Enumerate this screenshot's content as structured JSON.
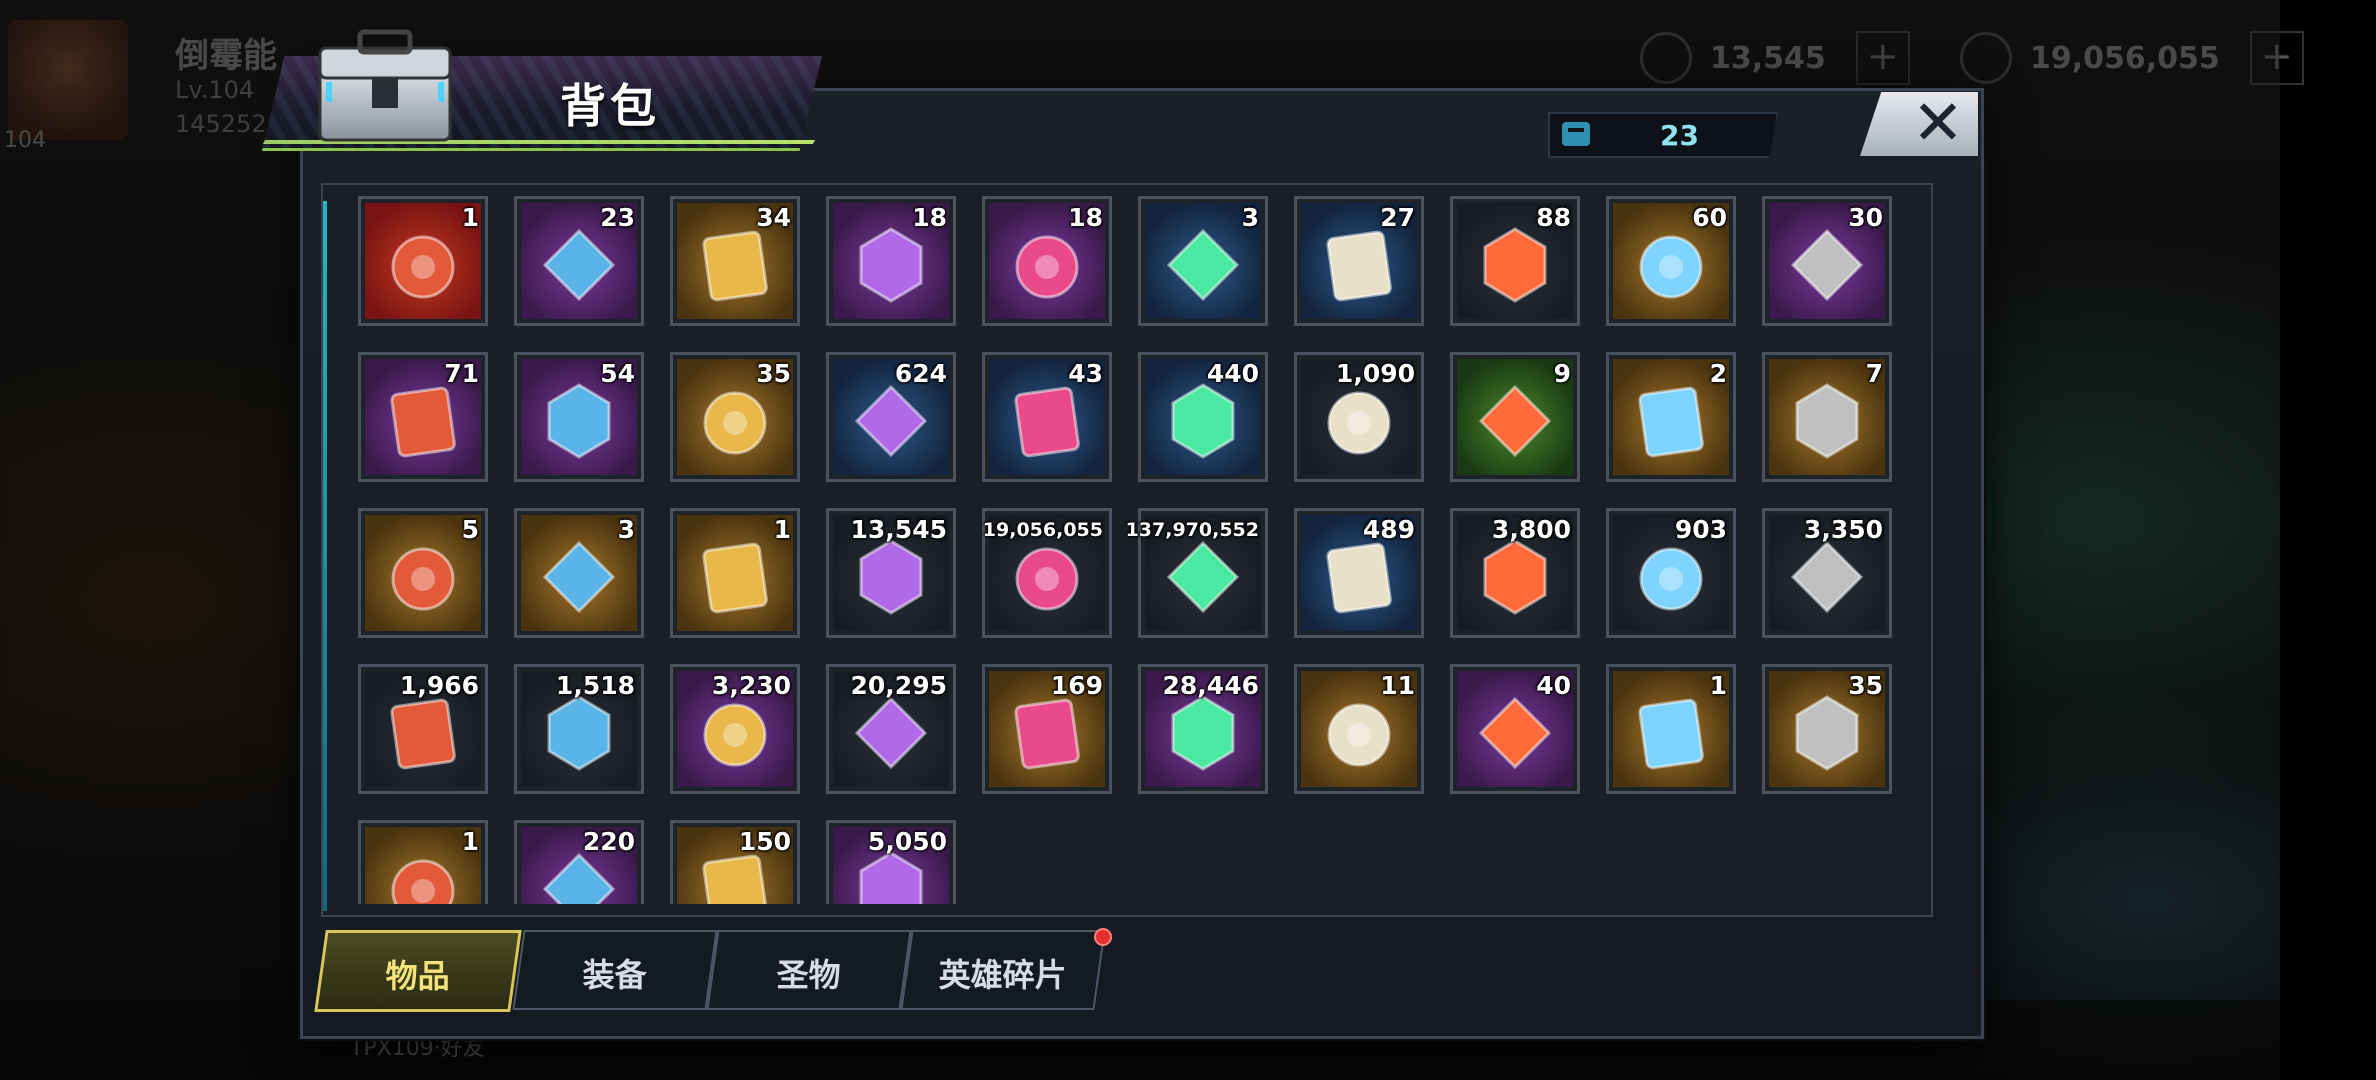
{
  "background": {
    "player_name": "倒霉能",
    "player_level": "Lv.104",
    "player_power": "145252",
    "player_badge": "104",
    "resource_1": "13,545",
    "resource_2": "19,056,055",
    "bottom_left_text": "TPX109·好友"
  },
  "header": {
    "title": "背包",
    "capacity": "23",
    "close_symbol": "✕"
  },
  "colors": {
    "accent_green": "#9ccc65",
    "accent_cyan": "#2bb3c9",
    "active_tab": "#d8c65a",
    "notification_red": "#e53030"
  },
  "items": [
    {
      "icon": "sss-chest-icon",
      "count": "1",
      "bg": "red"
    },
    {
      "icon": "wrench-tool-icon",
      "count": "23",
      "bg": "purple"
    },
    {
      "icon": "gold-speedup-24h-icon",
      "count": "34",
      "bg": "gold"
    },
    {
      "icon": "research-speedup-12h-icon",
      "count": "18",
      "bg": "purple"
    },
    {
      "icon": "gold-speedup-12h-icon",
      "count": "18",
      "bg": "purple"
    },
    {
      "icon": "research-speedup-4h-icon",
      "count": "3",
      "bg": "blue"
    },
    {
      "icon": "gold-speedup-4h-icon",
      "count": "27",
      "bg": "blue"
    },
    {
      "icon": "red-bottle-cap-icon",
      "count": "88",
      "bg": "dark"
    },
    {
      "icon": "golden-orb-icon",
      "count": "60",
      "bg": "gold"
    },
    {
      "icon": "film-reel-icon",
      "count": "30",
      "bg": "purple"
    },
    {
      "icon": "pink-bottle-cap-icon",
      "count": "71",
      "bg": "purple"
    },
    {
      "icon": "police-badge-icon",
      "count": "54",
      "bg": "purple"
    },
    {
      "icon": "blueberry-icon",
      "count": "35",
      "bg": "gold"
    },
    {
      "icon": "cinema-ticket-icon",
      "count": "624",
      "bg": "blue"
    },
    {
      "icon": "blue-bottle-cap-icon",
      "count": "43",
      "bg": "blue"
    },
    {
      "icon": "poker-chip-icon",
      "count": "440",
      "bg": "blue"
    },
    {
      "icon": "bullet-icon",
      "count": "1,090",
      "bg": "dark"
    },
    {
      "icon": "bowling-pin-icon",
      "count": "9",
      "bg": "green"
    },
    {
      "icon": "boot-blueprint-icon",
      "count": "2",
      "bg": "gold"
    },
    {
      "icon": "revolver-blueprint-icon",
      "count": "7",
      "bg": "gold"
    },
    {
      "icon": "arrow-blueprint-icon",
      "count": "5",
      "bg": "gold"
    },
    {
      "icon": "sword-blueprint-icon",
      "count": "3",
      "bg": "gold"
    },
    {
      "icon": "shirt-blueprint-icon",
      "count": "1",
      "bg": "gold"
    },
    {
      "icon": "purple-crystal-icon",
      "count": "13,545",
      "bg": "dark"
    },
    {
      "icon": "gold-coins-icon",
      "count": "19,056,055",
      "bg": "dark",
      "small": true
    },
    {
      "icon": "green-battery-icon",
      "count": "137,970,552",
      "bg": "dark",
      "small": true
    },
    {
      "icon": "purple-core-icon",
      "count": "489",
      "bg": "blue"
    },
    {
      "icon": "gear-icon",
      "count": "3,800",
      "bg": "dark"
    },
    {
      "icon": "red-token-icon",
      "count": "903",
      "bg": "dark"
    },
    {
      "icon": "eye-emblem-icon",
      "count": "3,350",
      "bg": "dark"
    },
    {
      "icon": "silver-triangle-icon",
      "count": "1,966",
      "bg": "dark"
    },
    {
      "icon": "golden-fist-icon",
      "count": "1,518",
      "bg": "dark"
    },
    {
      "icon": "puzzle-piece-icon",
      "count": "3,230",
      "bg": "purple"
    },
    {
      "icon": "ship-silver-icon",
      "count": "20,295",
      "bg": "dark"
    },
    {
      "icon": "ship-gold-icon",
      "count": "169",
      "bg": "gold"
    },
    {
      "icon": "red-hex-emblem-icon",
      "count": "28,446",
      "bg": "purple"
    },
    {
      "icon": "orange-triangle-icon",
      "count": "11",
      "bg": "gold"
    },
    {
      "icon": "lightning-medal-icon",
      "count": "40",
      "bg": "purple"
    },
    {
      "icon": "blue-propeller-icon",
      "count": "1",
      "bg": "gold"
    },
    {
      "icon": "pink-gem-ore-icon",
      "count": "35",
      "bg": "gold"
    },
    {
      "icon": "gold-shell-icon",
      "count": "1",
      "bg": "gold"
    },
    {
      "icon": "red-swirl-icon",
      "count": "220",
      "bg": "purple"
    },
    {
      "icon": "potion-bottles-icon",
      "count": "150",
      "bg": "gold"
    },
    {
      "icon": "blue-orb-icon",
      "count": "5,050",
      "bg": "purple"
    }
  ],
  "tabs": [
    {
      "label": "物品",
      "active": true
    },
    {
      "label": "装备",
      "active": false
    },
    {
      "label": "圣物",
      "active": false
    },
    {
      "label": "英雄碎片",
      "active": false
    }
  ]
}
